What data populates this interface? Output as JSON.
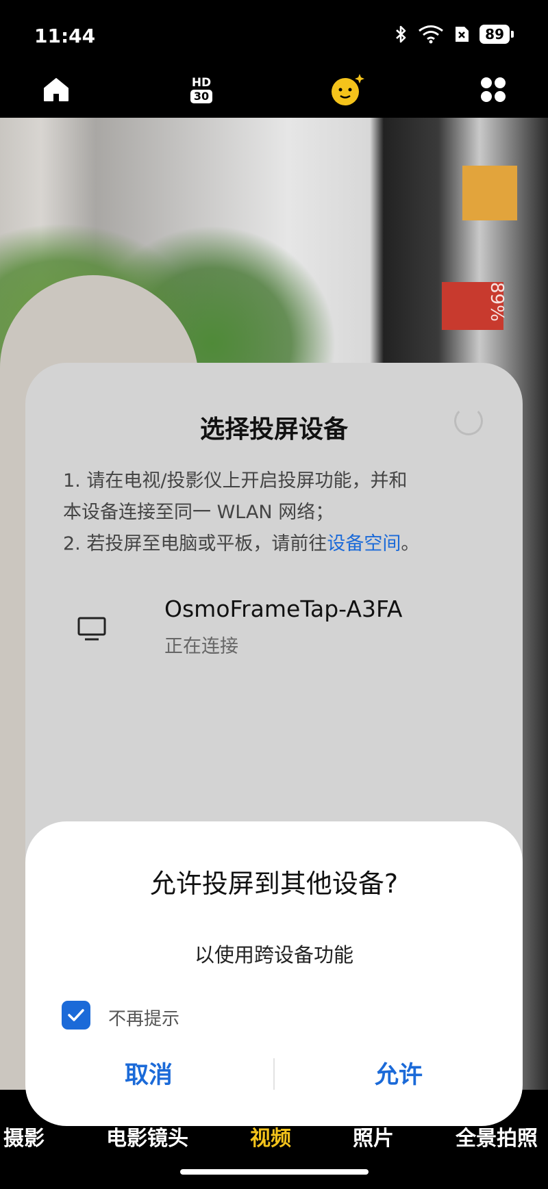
{
  "status_bar": {
    "time": "11:44",
    "battery": "89",
    "icons": [
      "bluetooth-icon",
      "wifi-icon",
      "sim-off-icon",
      "battery-icon"
    ]
  },
  "toolbar": {
    "hd_label": "HD",
    "fps_label": "30",
    "icons": [
      "home-icon",
      "face-icon",
      "grid-icon"
    ]
  },
  "camera": {
    "battery_overlay": "89%"
  },
  "cast_dialog": {
    "title": "选择投屏设备",
    "line1": "1. 请在电视/投影仪上开启投屏功能，并和",
    "line2": "本设备连接至同一 WLAN 网络；",
    "line3_prefix": "2. 若投屏至电脑或平板，请前往",
    "line3_link": "设备空间",
    "line3_suffix": "。",
    "device": {
      "name": "OsmoFrameTap-A3FA",
      "status": "正在连接"
    }
  },
  "permission_dialog": {
    "title": "允许投屏到其他设备?",
    "subtitle": "以使用跨设备功能",
    "checkbox_label": "不再提示",
    "checkbox_checked": true,
    "cancel_label": "取消",
    "allow_label": "允许"
  },
  "bottom_modes": [
    "摄影",
    "电影镜头",
    "视频",
    "照片",
    "全景拍照"
  ],
  "active_mode": "视频",
  "colors": {
    "accent": "#1b6ad8",
    "active_mode": "#f4c31b"
  }
}
